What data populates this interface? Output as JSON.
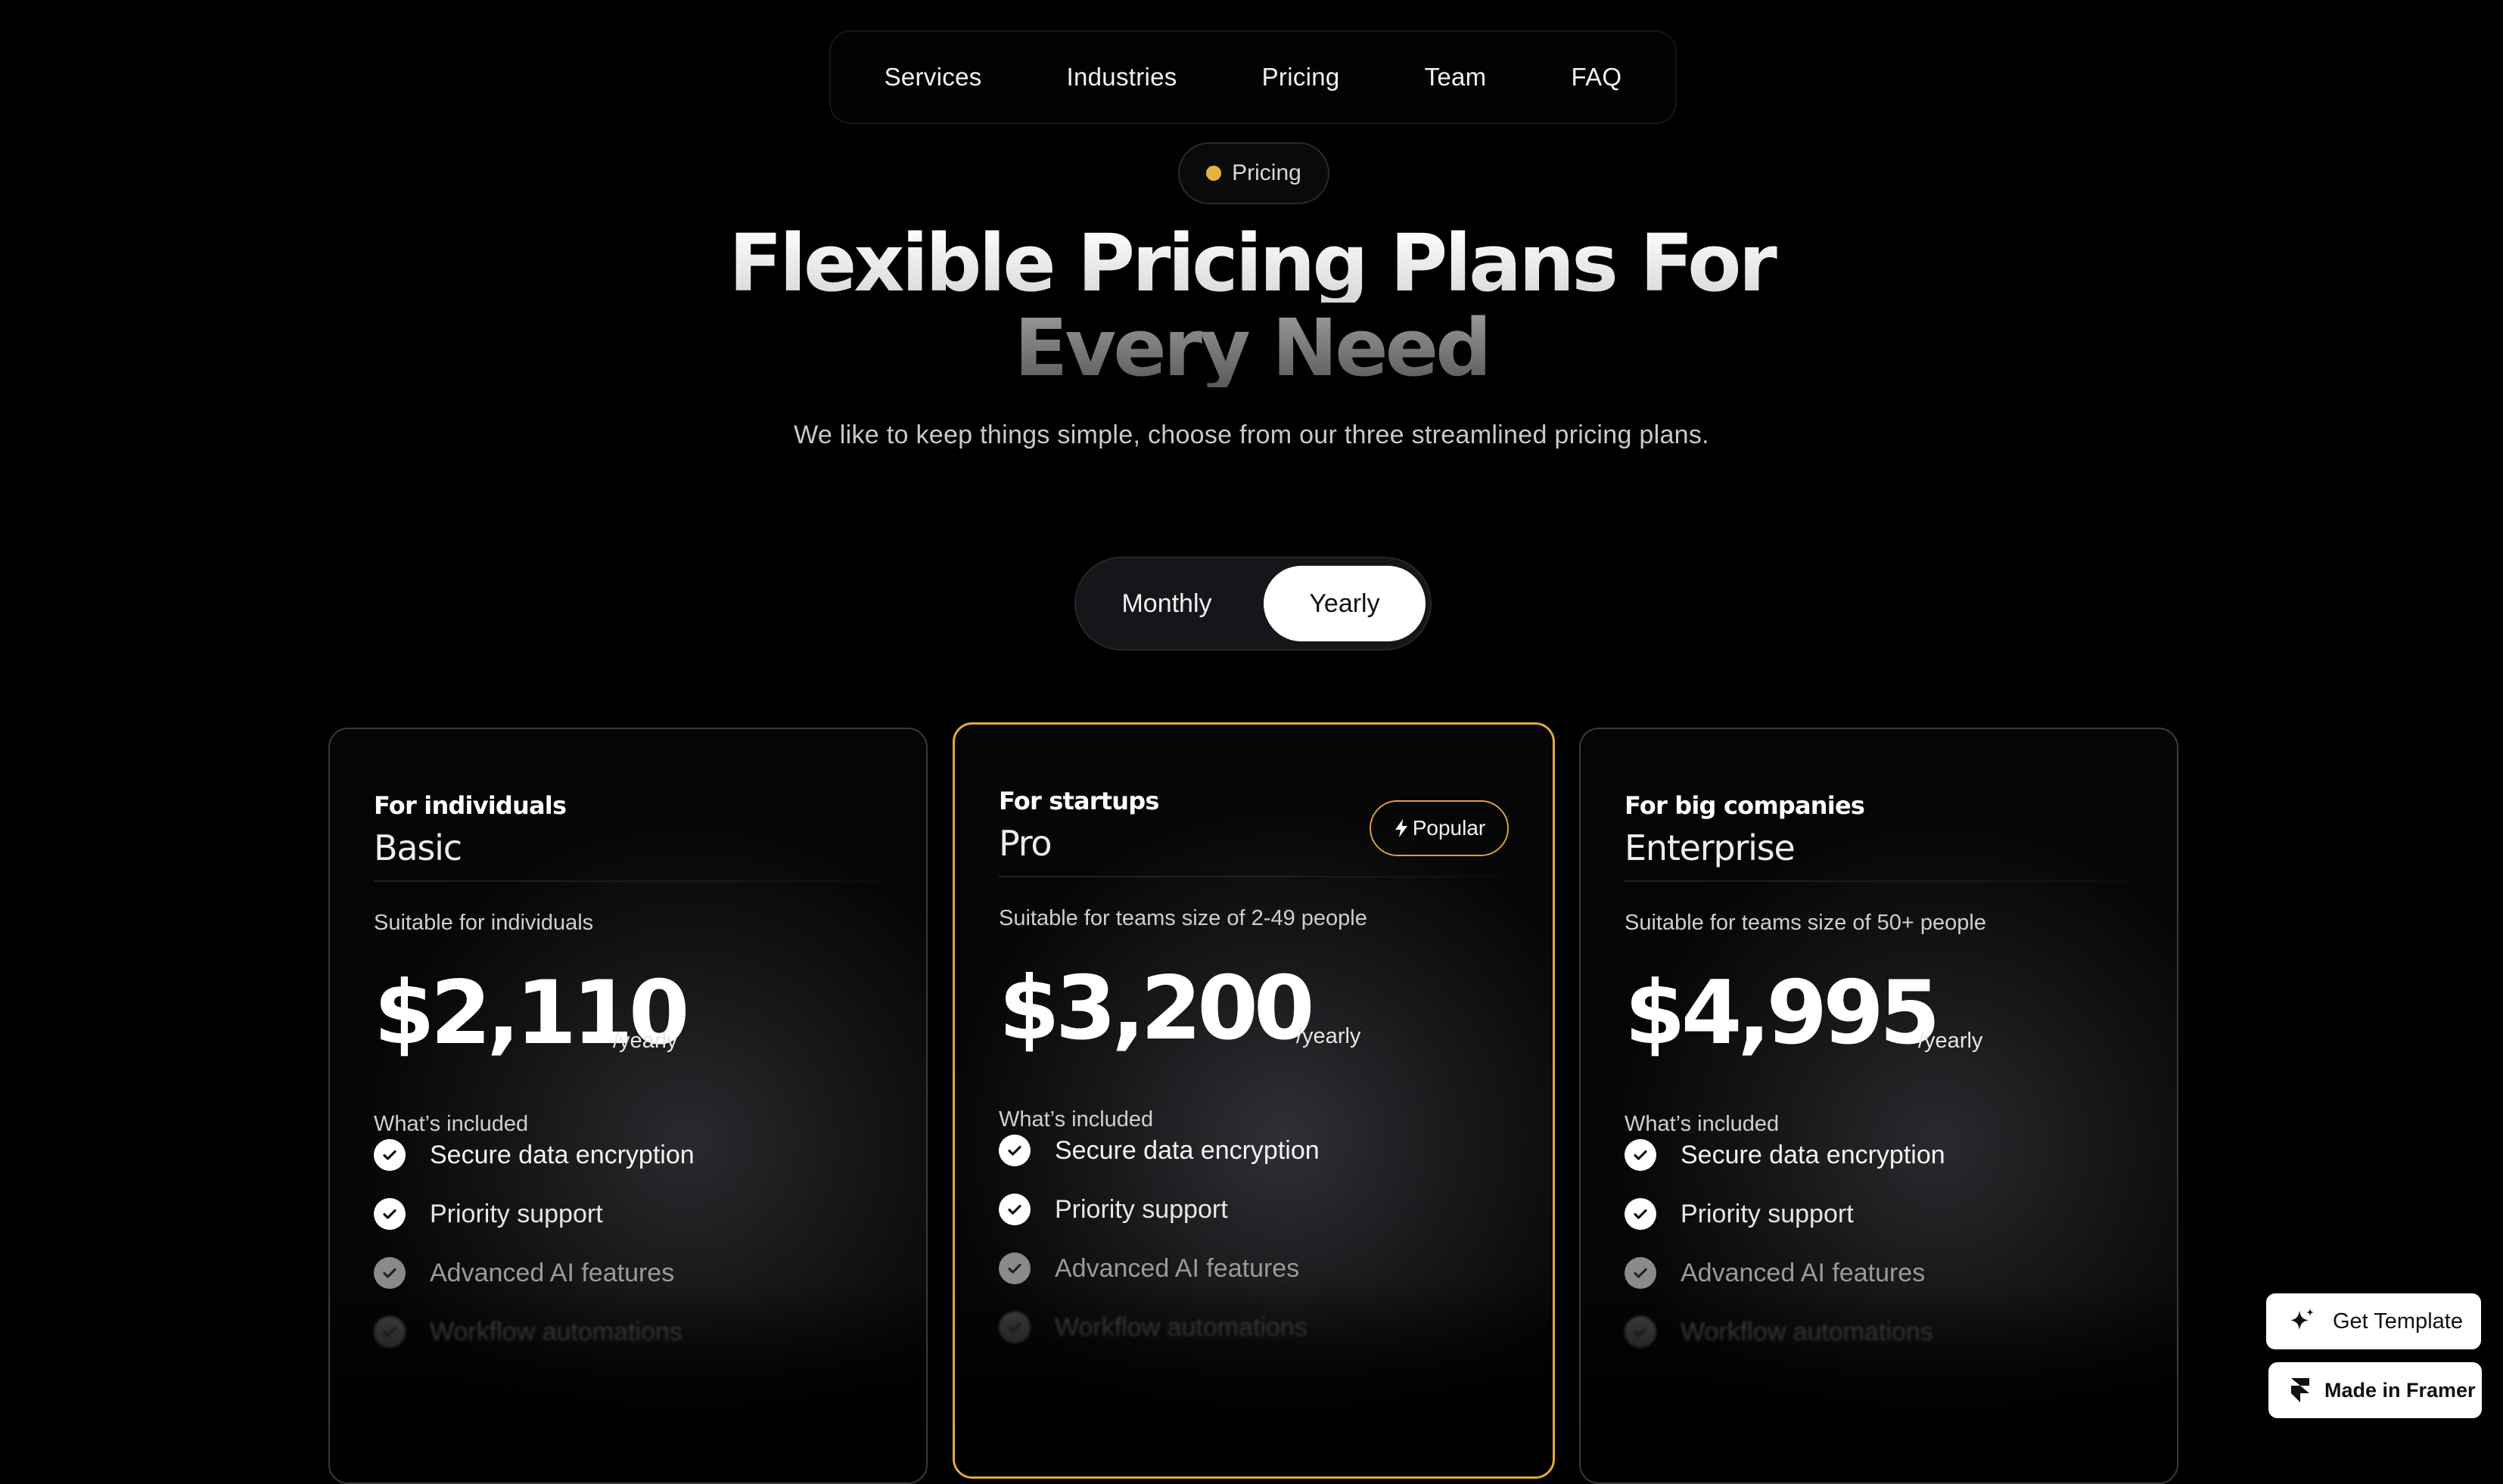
{
  "nav": {
    "items": [
      {
        "label": "Services"
      },
      {
        "label": "Industries"
      },
      {
        "label": "Pricing"
      },
      {
        "label": "Team"
      },
      {
        "label": "FAQ"
      }
    ]
  },
  "hero": {
    "badge_label": "Pricing",
    "badge_dot_color": "#e8b23c",
    "title_line_1": "Flexible Pricing Plans For",
    "title_line_2": "Every Need",
    "subtitle": "We like to keep things simple, choose from our three streamlined pricing plans."
  },
  "billing_toggle": {
    "options": [
      "Monthly",
      "Yearly"
    ],
    "selected": "Yearly"
  },
  "plans": [
    {
      "audience": "For individuals",
      "name": "Basic",
      "suitable": "Suitable for individuals",
      "price": "$2,110",
      "period": "/yearly",
      "included_label": "What’s included",
      "features": [
        "Secure data encryption",
        "Priority support",
        "Advanced AI features",
        "Workflow automations"
      ],
      "featured": false
    },
    {
      "audience": "For startups",
      "name": "Pro",
      "suitable": "Suitable for teams size of 2-49 people",
      "price": "$3,200",
      "period": "/yearly",
      "included_label": "What’s included",
      "features": [
        "Secure data encryption",
        "Priority support",
        "Advanced AI features",
        "Workflow automations"
      ],
      "featured": true,
      "badge": "Popular",
      "accent_color": "#e4a93a"
    },
    {
      "audience": "For big companies",
      "name": "Enterprise",
      "suitable": "Suitable for teams size of 50+ people",
      "price": "$4,995",
      "period": "/yearly",
      "included_label": "What’s included",
      "features": [
        "Secure data encryption",
        "Priority support",
        "Advanced AI features",
        "Workflow automations"
      ],
      "featured": false
    }
  ],
  "floating": {
    "get_template": {
      "label": "Get Template",
      "icon": "sparkle-icon"
    },
    "made_in_framer": {
      "label": "Made in Framer",
      "icon": "framer-logo-icon"
    }
  }
}
